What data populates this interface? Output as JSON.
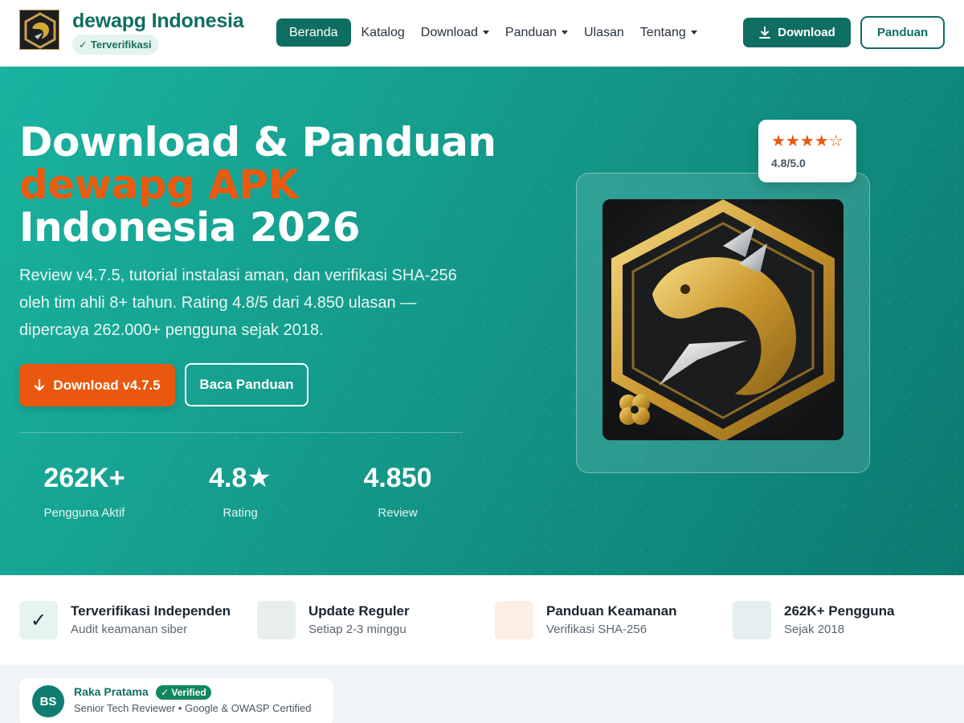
{
  "header": {
    "brand": "dewapg Indonesia",
    "verified_badge": "Terverifikasi",
    "nav": [
      {
        "label": "Beranda",
        "active": true,
        "dropdown": false
      },
      {
        "label": "Katalog",
        "active": false,
        "dropdown": false
      },
      {
        "label": "Download",
        "active": false,
        "dropdown": true
      },
      {
        "label": "Panduan",
        "active": false,
        "dropdown": true
      },
      {
        "label": "Ulasan",
        "active": false,
        "dropdown": false
      },
      {
        "label": "Tentang",
        "active": false,
        "dropdown": true
      }
    ],
    "download_button": "Download",
    "guide_button": "Panduan"
  },
  "hero": {
    "title_line1": "Download & Panduan",
    "title_line2": "dewapg APK",
    "title_line3": "Indonesia 2026",
    "description": "Review v4.7.5, tutorial instalasi aman, dan verifikasi SHA-256 oleh tim ahli 8+ tahun. Rating 4.8/5 dari 4.850 ulasan — dipercaya 262.000+ pengguna sejak 2018.",
    "download_button": "Download v4.7.5",
    "read_button": "Baca Panduan",
    "stats": [
      {
        "value": "262K+",
        "label": "Pengguna Aktif"
      },
      {
        "value": "4.8★",
        "label": "Rating"
      },
      {
        "value": "4.850",
        "label": "Review"
      }
    ],
    "rating_card": {
      "stars": "★★★★☆",
      "value": "4.8/5.0"
    }
  },
  "features": [
    {
      "icon": "checkmark-icon",
      "glyph": "✓",
      "bg": "#e6f4ef",
      "title": "Terverifikasi Independen",
      "subtitle": "Audit keamanan siber"
    },
    {
      "icon": "update-icon",
      "glyph": "",
      "bg": "#e7eeec",
      "title": "Update Reguler",
      "subtitle": "Setiap 2-3 minggu"
    },
    {
      "icon": "shield-icon",
      "glyph": "",
      "bg": "#fdeee4",
      "title": "Panduan Keamanan",
      "subtitle": "Verifikasi SHA-256"
    },
    {
      "icon": "users-icon",
      "glyph": "",
      "bg": "#e4eff0",
      "title": "262K+ Pengguna",
      "subtitle": "Sejak 2018"
    }
  ],
  "author": {
    "initials": "BS",
    "name": "Raka Pratama",
    "badge": "✓ Verified",
    "role": "Senior Tech Reviewer • Google & OWASP Certified"
  },
  "colors": {
    "brand": "#0f6e62",
    "accent": "#e9580e",
    "hero_start": "#19b3a0",
    "hero_end": "#0c7a70"
  }
}
